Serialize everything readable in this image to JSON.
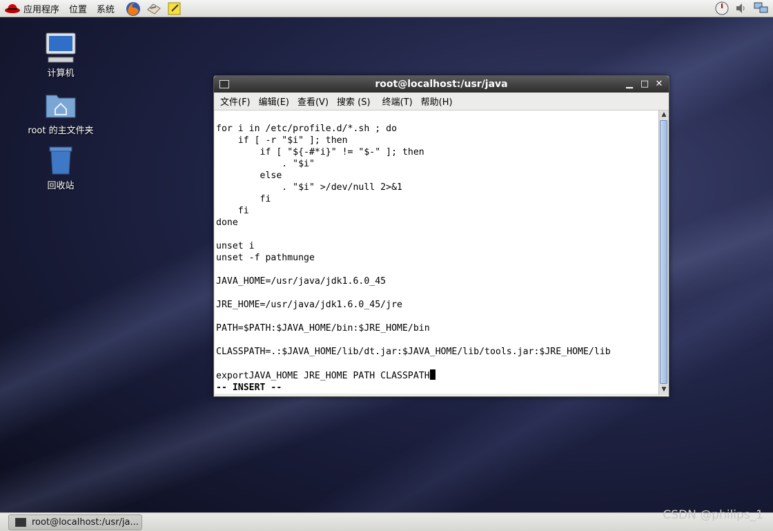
{
  "top_panel": {
    "menus": [
      "应用程序",
      "位置",
      "系统"
    ],
    "launchers": [
      "firefox-icon",
      "mail-icon",
      "notes-icon"
    ],
    "tray_icons": [
      "clock-icon",
      "volume-icon",
      "network-icon"
    ]
  },
  "desktop": {
    "icons": [
      {
        "label": "计算机",
        "icon": "computer-icon"
      },
      {
        "label": "root 的主文件夹",
        "icon": "home-folder-icon"
      },
      {
        "label": "回收站",
        "icon": "trash-icon"
      }
    ]
  },
  "terminal": {
    "title": "root@localhost:/usr/java",
    "menu": [
      "文件(F)",
      "编辑(E)",
      "查看(V)",
      "搜索 (S)",
      "终端(T)",
      "帮助(H)"
    ],
    "lines": [
      "for i in /etc/profile.d/*.sh ; do",
      "    if [ -r \"$i\" ]; then",
      "        if [ \"${-#*i}\" != \"$-\" ]; then",
      "            . \"$i\"",
      "        else",
      "            . \"$i\" >/dev/null 2>&1",
      "        fi",
      "    fi",
      "done",
      "",
      "unset i",
      "unset -f pathmunge",
      "",
      "JAVA_HOME=/usr/java/jdk1.6.0_45",
      "",
      "JRE_HOME=/usr/java/jdk1.6.0_45/jre",
      "",
      "PATH=$PATH:$JAVA_HOME/bin:$JRE_HOME/bin",
      "",
      "CLASSPATH=.:$JAVA_HOME/lib/dt.jar:$JAVA_HOME/lib/tools.jar:$JRE_HOME/lib",
      ""
    ],
    "current_line": "exportJAVA_HOME JRE_HOME PATH CLASSPATH",
    "mode_line": "-- INSERT --"
  },
  "taskbar": {
    "task_label": "root@localhost:/usr/ja..."
  },
  "watermark": "CSDN @philips_1"
}
